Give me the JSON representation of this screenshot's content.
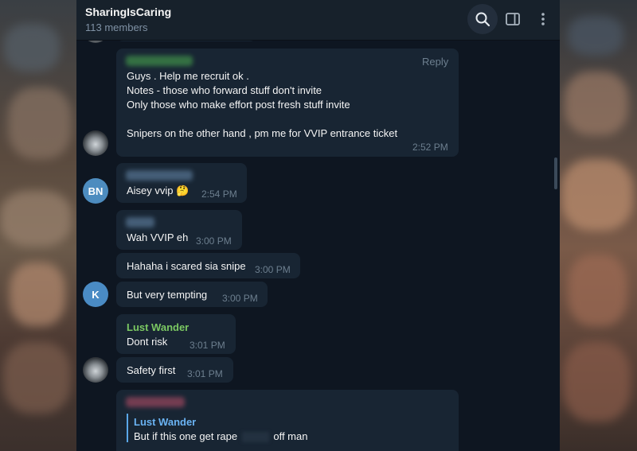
{
  "header": {
    "title": "SharingIsCaring",
    "members": "113 members",
    "icons": [
      "search-icon",
      "sidebar-panel-icon",
      "more-vertical-icon"
    ]
  },
  "colors": {
    "chat_bg": "#0e1621",
    "bubble_bg": "#182533",
    "header_bg": "#17212b",
    "accent_green": "#7bc862",
    "accent_blue": "#6ab3f3",
    "time_gray": "#6d7f8f"
  },
  "messages": [
    {
      "reply_label": "Reply",
      "lines": [
        "Guys . Help me recruit ok .",
        "Notes - those who forward stuff don't invite",
        "Only those who make effort post fresh stuff invite",
        "",
        "Snipers on the other hand , pm me for VVIP entrance ticket"
      ],
      "time": "2:52 PM"
    },
    {
      "avatar": "BN",
      "text": "Aisey vvip 🤔",
      "time": "2:54 PM"
    },
    {
      "text": "Wah VVIP eh",
      "time": "3:00 PM"
    },
    {
      "text": "Hahaha i scared sia snipe",
      "time": "3:00 PM"
    },
    {
      "avatar": "K",
      "text": "But very tempting",
      "time": "3:00 PM"
    },
    {
      "sender": "Lust Wander",
      "text": "Dont risk",
      "time": "3:01 PM"
    },
    {
      "text": "Safety first",
      "time": "3:01 PM"
    },
    {
      "reply_to": "Lust Wander",
      "reply_text_start": "But if this one get rape",
      "reply_text_end": "off man"
    }
  ]
}
